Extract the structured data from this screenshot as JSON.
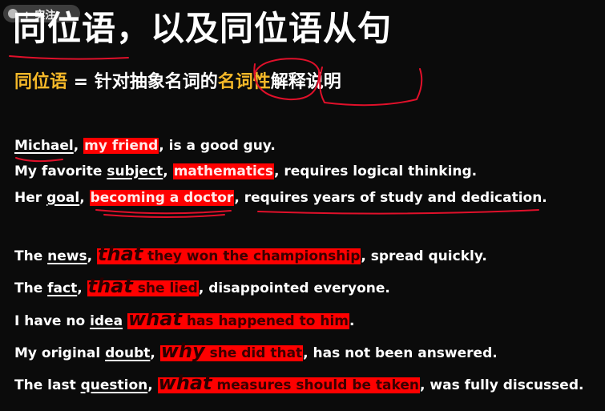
{
  "toolbar": {
    "label": "+ 实注"
  },
  "title": "同位语，以及同位语从句",
  "definition": {
    "term": "同位语",
    "mid": " = 针对抽象名词的",
    "highlight": "名词性",
    "tail": "解释说明"
  },
  "sentences": [
    {
      "a": "Michael",
      "b": ", ",
      "c": "my friend",
      "d": ", is a good guy."
    },
    {
      "a": "My favorite ",
      "b": "subject",
      "c": ", ",
      "d": "mathematics",
      "e": ", requires logical thinking."
    },
    {
      "a": "Her ",
      "b": "goal",
      "c": ", ",
      "d": "becoming a doctor",
      "e": ", requires years of study and dedication."
    }
  ],
  "clauses": [
    {
      "pre": "The ",
      "noun": "news",
      "sep": ", ",
      "conj": "that",
      "rest": " they won the championship",
      "post": ", spread quickly."
    },
    {
      "pre": "The ",
      "noun": "fact",
      "sep": ", ",
      "conj": "that",
      "rest": " she lied",
      "post": ", disappointed everyone."
    },
    {
      "pre": "I have no ",
      "noun": "idea",
      "sep": " ",
      "conj": "what",
      "rest": " has happened to him",
      "post": "."
    },
    {
      "pre": "My original ",
      "noun": "doubt",
      "sep": ", ",
      "conj": "why",
      "rest": " she did that",
      "post": ", has not been answered."
    },
    {
      "pre": "The last ",
      "noun": "question",
      "sep": ", ",
      "conj": "what",
      "rest": " measures should be taken",
      "post": ", was fully discussed."
    }
  ],
  "colors": {
    "accent": "#f4b829",
    "highlight": "#ff0000",
    "ink": "#e0102a"
  }
}
